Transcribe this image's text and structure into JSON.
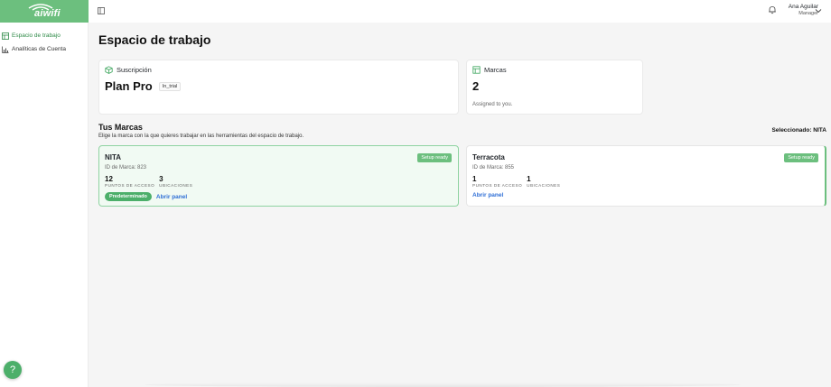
{
  "sidebar": {
    "logo_text": "aiwifi",
    "items": [
      {
        "label": "Espacio de trabajo",
        "icon": "grid-icon",
        "active": true
      },
      {
        "label": "Analíticas de Cuenta",
        "icon": "bar-chart-icon",
        "active": false
      }
    ],
    "help_label": "?"
  },
  "user": {
    "name": "Ana Aguilar",
    "role": "Manager"
  },
  "page": {
    "title": "Espacio de trabajo"
  },
  "subscription": {
    "heading": "Suscripción",
    "plan": "Plan Pro",
    "status": "In_trial"
  },
  "brands_summary": {
    "heading": "Marcas",
    "count": "2",
    "assigned": "Assigned to you."
  },
  "brands_section": {
    "title": "Tus Marcas",
    "subtitle": "Elige la marca con la que quieres trabajar en las herramientas del espacio de trabajo.",
    "selected": "Seleccionado: NITA"
  },
  "brands": [
    {
      "name": "NITA",
      "badge": "Setup ready",
      "id_text": "ID de Marca: 823",
      "access_points": "12",
      "access_label": "Puntos de acceso",
      "locations": "3",
      "locations_label": "Ubicaciones",
      "default_label": "Predeterminado",
      "open_label": "Abrir panel"
    },
    {
      "name": "Terracota",
      "badge": "Setup ready",
      "id_text": "ID de Marca: 855",
      "access_points": "1",
      "access_label": "Puntos de acceso",
      "locations": "1",
      "locations_label": "Ubicaciones",
      "open_label": "Abrir panel"
    }
  ],
  "colors": {
    "accent": "#6cbf7e",
    "link": "#2f6fd6"
  }
}
